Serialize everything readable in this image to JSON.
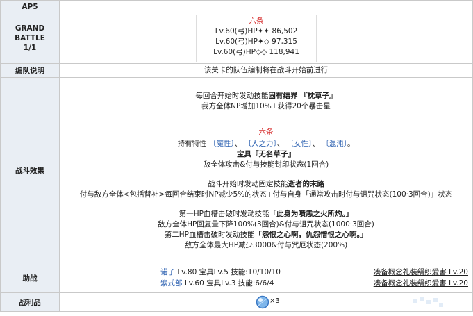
{
  "ap": {
    "label": "AP5"
  },
  "grand_battle": {
    "label_lines": [
      "GRAND",
      "BATTLE",
      "1/1"
    ]
  },
  "enemy": {
    "name": "六条",
    "lines": [
      "Lv.60(弓)HP✦✦ 86,502",
      "Lv.60(弓)HP✦◇ 97,315",
      "Lv.60(弓)HP◇◇ 118,941"
    ]
  },
  "formation": {
    "label": "编队说明",
    "text": "该关卡的队伍编制将在战斗开始前进行"
  },
  "battle_effects": {
    "label": "战斗效果",
    "line1": "每回合开始时发动技能",
    "line1_bold": "固有结界 『枕草子』",
    "line2": "我方全体NP增加10%+获得20个暴击星",
    "name": "六条",
    "traits_prefix": "持有特性",
    "traits": [
      "〔魔性〕",
      "〔人之力〕",
      "〔女性〕",
      "〔混沌〕"
    ],
    "np_label": "宝具『无名草子』",
    "np_desc": "敌全体攻击&付与技能封印状态(1回合)",
    "skill_line": "战斗开始时发动固定技能",
    "skill_bold": "逝者的末路",
    "skill_desc": "付与敌方全体<包括替补>每回合结束时NP减少5%的状态+付与自身「通常攻击时付与诅咒状态(100·3回合)」状态",
    "hp1_prefix": "第一HP血槽击破时发动技能",
    "hp1_bold": "「此身为噴恚之火所灼。」",
    "hp1_desc": "敌方全体HP回复量下降100%(3回合)&付与诅咒状态(1000·3回合)",
    "hp2_prefix": "第二HP血槽击破时发动技能",
    "hp2_bold": "「怨恨之心啊，仇怨憎恨之心啊。」",
    "hp2_desc": "敌方全体最大HP减少3000&付与咒厄状态(200%)"
  },
  "support": {
    "label": "助战",
    "rows": [
      {
        "name": "诺子",
        "info": " Lv.80 宝具Lv.5 技能:10/10/10",
        "ce": "凑备概念礼装绢织爱害 Lv.20"
      },
      {
        "name": "紫式部",
        "info": " Lv.60 宝具Lv.3 技能:6/6/4",
        "ce": "凑备概念礼装绢织爱害 Lv.20"
      }
    ]
  },
  "drops": {
    "label": "战利品",
    "icon": "blue-orb-icon",
    "count": "×3"
  },
  "colors": {
    "header_bg": "#e9eef4",
    "red": "#d62d2d",
    "link": "#2a5fb0"
  }
}
